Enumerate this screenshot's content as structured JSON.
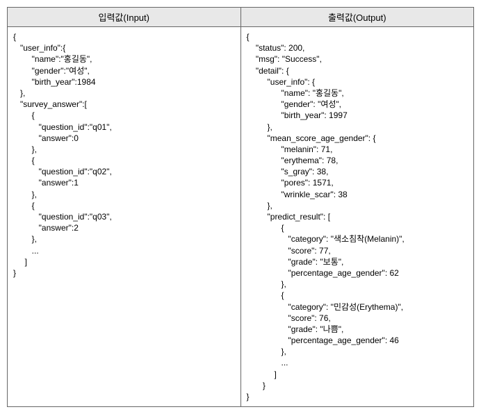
{
  "headers": {
    "input": "입력값(Input)",
    "output": "출력값(Output)"
  },
  "input_code": "{\n   \"user_info\":{\n        \"name\":\"홍길동\",\n        \"gender\":\"여성\",\n        \"birth_year\":1984\n   },\n   \"survey_answer\":[\n        {\n           \"question_id\":\"q01\",\n           \"answer\":0\n        },\n        {\n           \"question_id\":\"q02\",\n           \"answer\":1\n        },\n        {\n           \"question_id\":\"q03\",\n           \"answer\":2\n        },\n        ...\n     ]\n}",
  "output_code": "{\n    \"status\": 200,\n    \"msg\": \"Success\",\n    \"detail\": {\n         \"user_info\": {\n               \"name\": \"홍길동\",\n               \"gender\": \"여성\",\n               \"birth_year\": 1997\n         },\n         \"mean_score_age_gender\": {\n               \"melanin\": 71,\n               \"erythema\": 78,\n               \"s_gray\": 38,\n               \"pores\": 1571,\n               \"wrinkle_scar\": 38\n         },\n         \"predict_result\": [\n               {\n                  \"category\": \"색소침착(Melanin)\",\n                  \"score\": 77,\n                  \"grade\": \"보통\",\n                  \"percentage_age_gender\": 62\n               },\n               {\n                  \"category\": \"민감성(Erythema)\",\n                  \"score\": 76,\n                  \"grade\": \"나쁨\",\n                  \"percentage_age_gender\": 46\n               },\n               ...\n            ]\n       }\n}"
}
